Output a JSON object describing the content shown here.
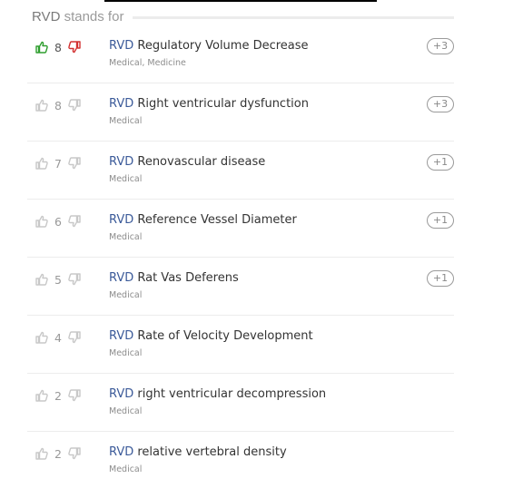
{
  "header": {
    "abbr": "RVD",
    "suffix": " stands for"
  },
  "colors": {
    "thumb_up_active": "#2e9e2e",
    "thumb_down_active": "#d23030",
    "thumb_inactive": "#c8c8c8",
    "abbr_link": "#3b5a99"
  },
  "rows": [
    {
      "abbr": "RVD",
      "meaning": " Regulatory Volume Decrease",
      "categories": "Medical, Medicine",
      "votes": "8",
      "badge": "+3",
      "up_icon": "thumbs-up-icon",
      "down_icon": "thumbs-down-icon"
    },
    {
      "abbr": "RVD",
      "meaning": " Right ventricular dysfunction",
      "categories": "Medical",
      "votes": "8",
      "badge": "+3"
    },
    {
      "abbr": "RVD",
      "meaning": " Renovascular disease",
      "categories": "Medical",
      "votes": "7",
      "badge": "+1"
    },
    {
      "abbr": "RVD",
      "meaning": " Reference Vessel Diameter",
      "categories": "Medical",
      "votes": "6",
      "badge": "+1"
    },
    {
      "abbr": "RVD",
      "meaning": " Rat Vas Deferens",
      "categories": "Medical",
      "votes": "5",
      "badge": "+1"
    },
    {
      "abbr": "RVD",
      "meaning": " Rate of Velocity Development",
      "categories": "Medical",
      "votes": "4",
      "badge": ""
    },
    {
      "abbr": "RVD",
      "meaning": " right ventricular decompression",
      "categories": "Medical",
      "votes": "2",
      "badge": ""
    },
    {
      "abbr": "RVD",
      "meaning": " relative vertebral density",
      "categories": "Medical",
      "votes": "2",
      "badge": ""
    }
  ]
}
